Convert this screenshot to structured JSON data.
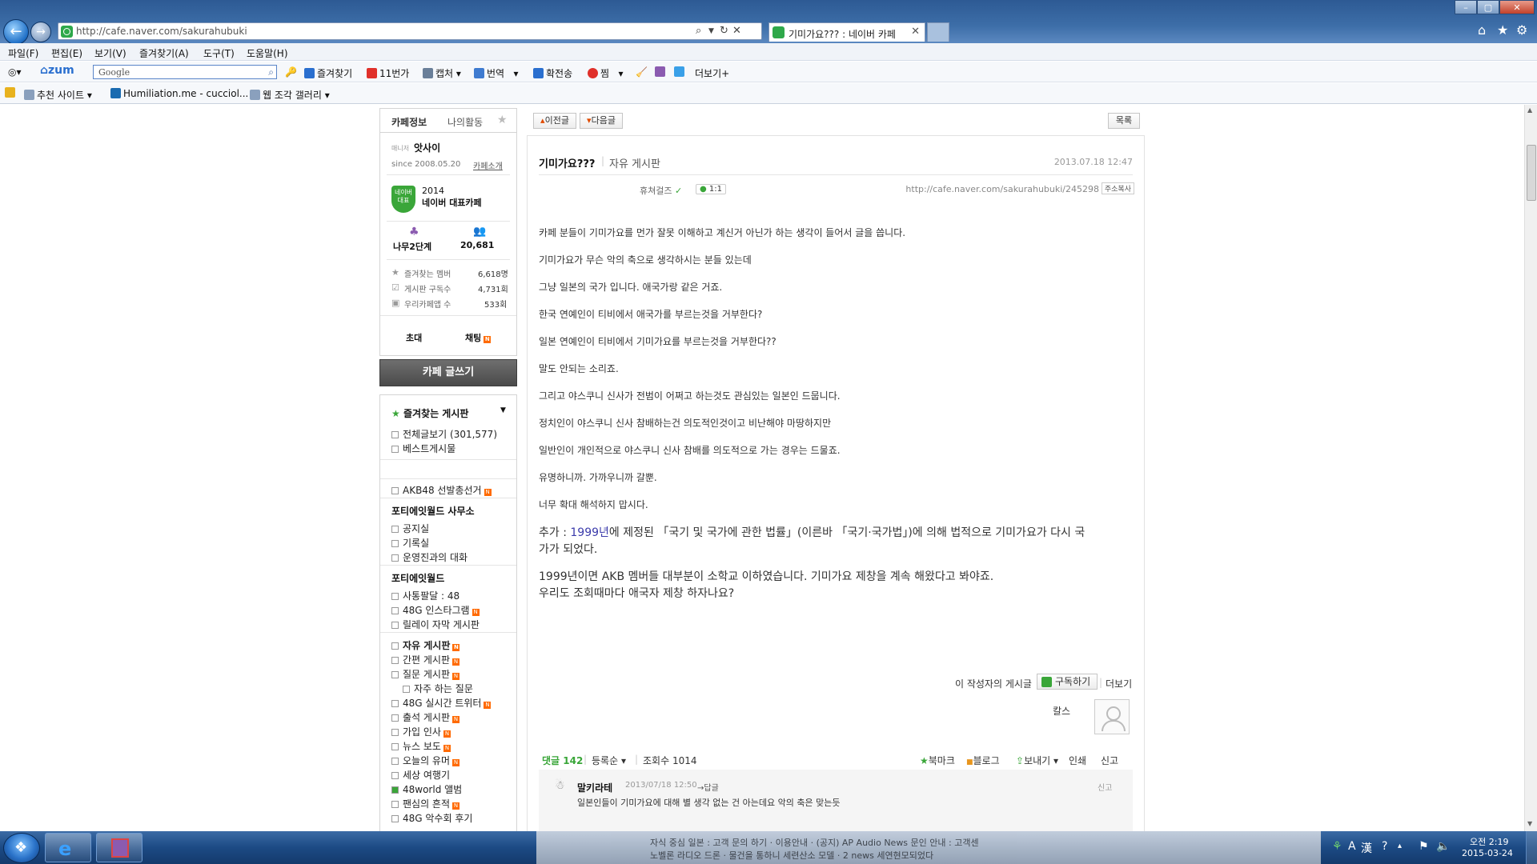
{
  "browser": {
    "url": "http://cafe.naver.com/sakurahubuki",
    "tab_title": "기미가요??? : 네이버 카페",
    "menu": [
      "파일(F)",
      "편집(E)",
      "보기(V)",
      "즐겨찾기(A)",
      "도구(T)",
      "도움말(H)"
    ],
    "toolbar": {
      "zum": "zum",
      "search_placeholder": "Google",
      "favorites": "즐겨찾기",
      "store11": "11번가",
      "capture": "캡처",
      "translate": "번역",
      "broadcast": "확전송",
      "heart": "찜",
      "more": "더보기+"
    },
    "favbar": [
      "추천 사이트",
      "Humiliation.me - cucciol...",
      "웹 조각 갤러리"
    ]
  },
  "sidebar": {
    "tabs": [
      "카페정보",
      "나의활동"
    ],
    "cafe_prefix": "매니저",
    "cafe_name": "앗사이",
    "since": "since 2008.05.20",
    "cafe_intro": "카페소개",
    "award_year": "2014",
    "award_title": "네이버 대표카페",
    "badge_text": "네이버\n대표카페",
    "level": "나무2단계",
    "members": "20,681",
    "stats": [
      {
        "label": "즐겨찾는 멤버",
        "value": "6,618명"
      },
      {
        "label": "게시판 구독수",
        "value": "4,731회"
      },
      {
        "label": "우리카페앱 수",
        "value": "533회"
      }
    ],
    "invite": "초대",
    "chat": "채팅",
    "write": "카페 글쓰기",
    "fav_boards_title": "즐겨찾는 게시판",
    "all_posts": "전체글보기 (301,577)",
    "best_posts": "베스트게시물",
    "akb_election": "AKB48 선발총선거",
    "office_title": "포티에잇월드 사무소",
    "office_items": [
      "공지실",
      "기록실",
      "운영진과의 대화"
    ],
    "world_title": "포티에잇월드",
    "world_items": [
      "사통팔달 : 48",
      "48G 인스타그램",
      "릴레이 자막 게시판"
    ],
    "free_items": [
      "자유 게시판",
      "간편 게시판",
      "질문 게시판",
      "자주 하는 질문",
      "48G 실시간 트위터",
      "출석 게시판",
      "가입 인사",
      "뉴스 보도",
      "오늘의 유머",
      "세상 여행기",
      "48world 앨범",
      "팬심의 흔적",
      "48G 악수회 후기"
    ]
  },
  "article": {
    "prev": "이전글",
    "next": "다음글",
    "list": "목록",
    "title": "기미가요???",
    "board": "자유 게시판",
    "date": "2013.07.18 12:47",
    "author": "휴쳐걸즈",
    "comment_badge": "1:1",
    "permalink": "http://cafe.naver.com/sakurahubuki/245298",
    "copy_url": "주소복사",
    "paragraphs": [
      "카페 분들이 기미가요를 먼가 잘못 이해하고 계신거 아닌가 하는 생각이 들어서 글을 씁니다.",
      "기미가요가 무슨 악의 축으로 생각하시는 분들 있는데",
      "그냥 일본의 국가 입니다. 애국가랑 같은 거죠.",
      "한국 연예인이 티비에서 애국가를 부르는것을 거부한다?",
      "일본 연예인이 티비에서 기미가요를 부르는것을 거부한다??",
      "말도 안되는 소리죠.",
      "그리고 야스쿠니 신사가 전범이 어쩌고 하는것도 관심있는 일본인 드뭅니다.",
      "정치인이 야스쿠니 신사 참배하는건 의도적인것이고 비난해야 마땅하지만",
      "일반인이 개인적으로 야스쿠니 신사 참배를 의도적으로 가는 경우는 드물죠.",
      "유명하니까. 가까우니까 갈뿐.",
      "너무 확대 해석하지 맙시다."
    ],
    "add_prefix": "추가 : ",
    "add_year": "1999년",
    "add_rest": "에 제정된 「국기 및 국가에 관한 법률」(이른바 「국기·국가법」)에 의해 법적으로 기미가요가 다시 국",
    "add_line2": "가가 되었다.",
    "extra1": "1999년이면 AKB 멤버들 대부분이 소학교 이하였습니다. 기미가요 제창을 계속 해왔다고 봐야죠.",
    "extra2": "우리도 조회때마다 애국자 제창 하자나요?",
    "author_posts": "이 작성자의 게시글",
    "subscribe": "구독하기",
    "more": "더보기",
    "author_nick": "칼스"
  },
  "comments": {
    "label": "댓글",
    "count": "142",
    "sort": "등록순",
    "views_label": "조회수",
    "views": "1014",
    "bookmark": "북마크",
    "blog": "블로그",
    "send": "보내기",
    "print": "인쇄",
    "report": "신고",
    "first": {
      "nick": "말키라테",
      "date": "2013/07/18 12:50",
      "reply": "답글",
      "report": "신고",
      "text": "일본인들이 기미가요에 대해 별 생각 없는 건 아는데요 악의 축은 맞는듯"
    }
  },
  "taskbar": {
    "notice1": "자식 중심 일본 : 고객 문의 하기 · 이용안내 · (공지) AP Audio News 문인 안내 : 고객센",
    "notice2": "노벨론 라디오 드론 · 물건을 통하니 세련산소 모델 · 2 news 세연현모되었다",
    "time": "오전 2:19",
    "date": "2015-03-24"
  },
  "colors": {
    "naver_green": "#3aa639",
    "link_blue": "#3b3bab",
    "new_badge": "#ff6a00"
  }
}
